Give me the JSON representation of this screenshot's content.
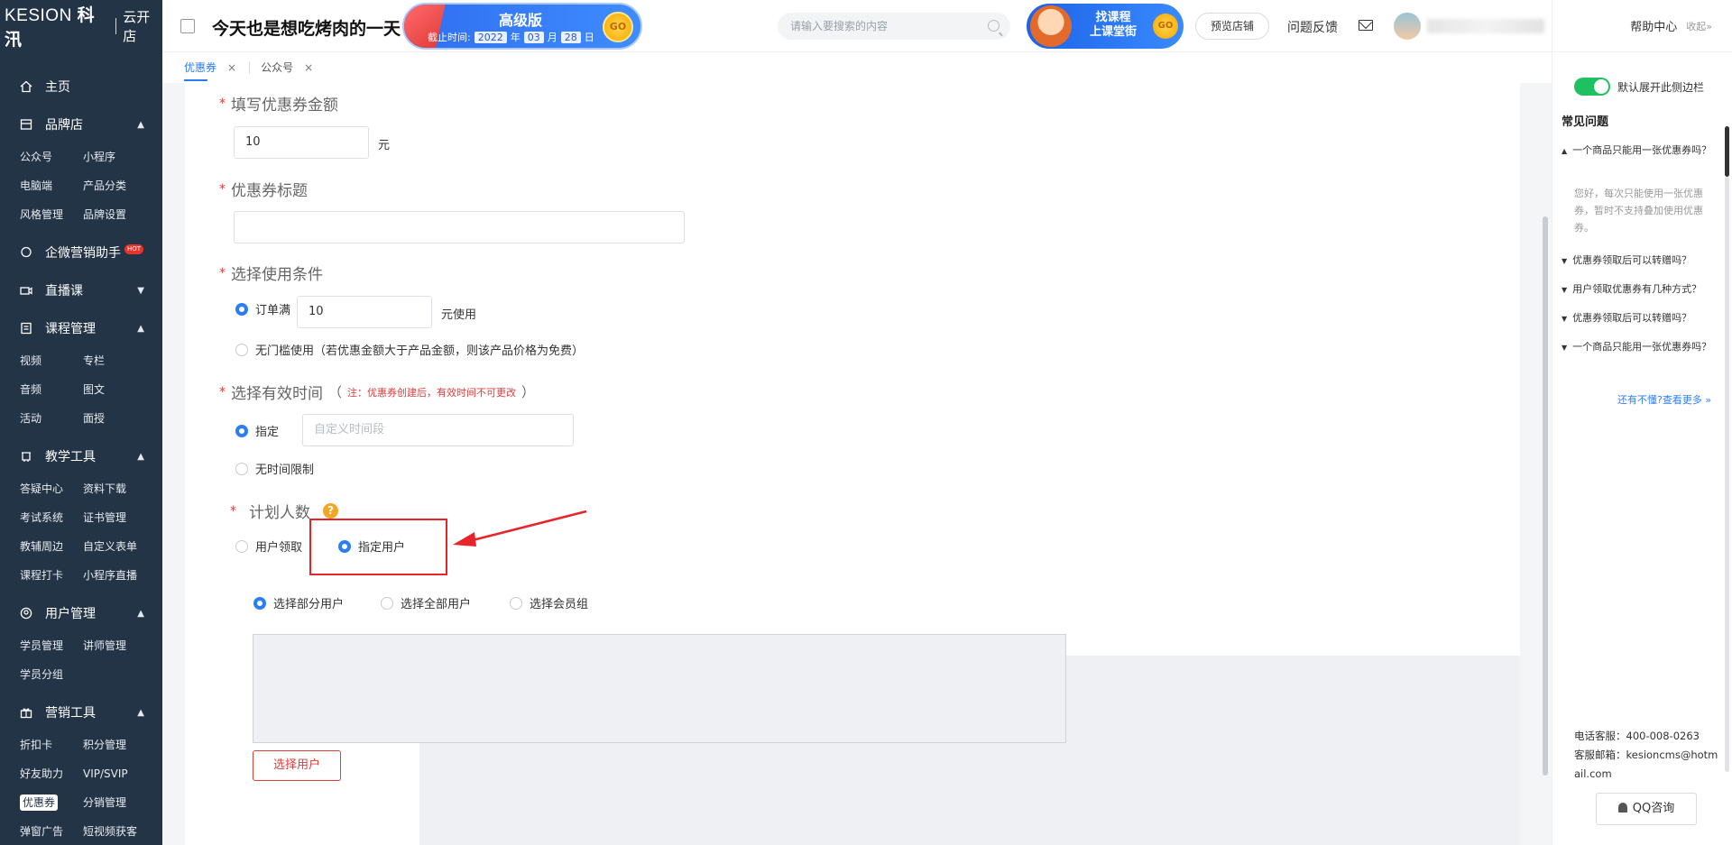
{
  "sidebar": {
    "brand": "KESION",
    "brand_cn": "科汛",
    "edition": "云开店",
    "home": "主页",
    "groups": [
      {
        "title": "品牌店",
        "items": [
          "公众号",
          "小程序",
          "电脑端",
          "产品分类",
          "风格管理",
          "品牌设置"
        ]
      },
      {
        "title": "企微营销助手",
        "badge": "HOT",
        "items": []
      },
      {
        "title": "直播课",
        "items": []
      },
      {
        "title": "课程管理",
        "items": [
          "视频",
          "专栏",
          "音频",
          "图文",
          "活动",
          "面授"
        ]
      },
      {
        "title": "教学工具",
        "items": [
          "答疑中心",
          "资料下载",
          "考试系统",
          "证书管理",
          "教辅周边",
          "自定义表单",
          "课程打卡",
          "小程序直播"
        ]
      },
      {
        "title": "用户管理",
        "items": [
          "学员管理",
          "讲师管理",
          "学员分组"
        ]
      },
      {
        "title": "营销工具",
        "items": [
          "折扣卡",
          "积分管理",
          "好友助力",
          "VIP/SVIP",
          "优惠券",
          "分销管理",
          "弹窗广告",
          "短视频获客"
        ]
      }
    ],
    "active_item": "优惠券"
  },
  "header": {
    "store_name": "今天也是想吃烤肉的一天",
    "vip": {
      "level": "高级版",
      "expire_label": "截止时间:",
      "year": "2022",
      "year_u": "年",
      "month": "03",
      "month_u": "月",
      "day": "28",
      "day_u": "日",
      "go": "GO"
    },
    "search_placeholder": "请输入要搜索的内容",
    "course_banner": {
      "line1": "找课程",
      "line2": "上课堂街",
      "go": "GO"
    },
    "preview": "预览店铺",
    "feedback": "问题反馈"
  },
  "tabs": [
    {
      "label": "优惠券",
      "close": "×"
    },
    {
      "label": "公众号",
      "close": "×"
    }
  ],
  "form": {
    "amount_label": "填写优惠券金额",
    "amount_value": "10",
    "amount_unit": "元",
    "title_label": "优惠券标题",
    "title_value": "",
    "condition_label": "选择使用条件",
    "cond_full": "订单满",
    "cond_full_value": "10",
    "cond_full_suffix": "元使用",
    "cond_none": "无门槛使用（若优惠金额大于产品金额，则该产品价格为免费）",
    "time_label": "选择有效时间",
    "time_note_open": "（",
    "time_note": "注：优惠券创建后，有效时间不可更改",
    "time_note_close": "）",
    "time_fixed": "指定",
    "time_placeholder": "自定义时间段",
    "time_unlimited": "无时间限制",
    "plan_label": "计划人数",
    "plan_help": "?",
    "plan_user_claim": "用户领取",
    "plan_designated": "指定用户",
    "scope_part": "选择部分用户",
    "scope_all": "选择全部用户",
    "scope_group": "选择会员组",
    "pick_users": "选择用户"
  },
  "help": {
    "title": "帮助中心",
    "collapse": "收起»",
    "toggle_label": "默认展开此侧边栏",
    "faq_title": "常见问题",
    "faqs": [
      {
        "q": "一个商品只能用一张优惠券吗？",
        "open": true
      },
      {
        "q": "优惠券领取后可以转赠吗？",
        "open": false
      },
      {
        "q": "用户领取优惠券有几种方式？",
        "open": false
      },
      {
        "q": "优惠券领取后可以转赠吗？",
        "open": false
      },
      {
        "q": "一个商品只能用一张优惠券吗？",
        "open": false
      }
    ],
    "answer": "您好，每次只能使用一张优惠券，暂时不支持叠加使用优惠券。",
    "more": "还有不懂?查看更多 »",
    "phone": "电话客服：400-008-0263",
    "email": "客服邮箱：kesioncms@hotmail.com",
    "qq": "QQ咨询"
  },
  "colors": {
    "sidebar_bg": "#243447",
    "accent": "#2c7ef8",
    "danger": "#e23b3b",
    "toggle_on": "#1ec161"
  }
}
